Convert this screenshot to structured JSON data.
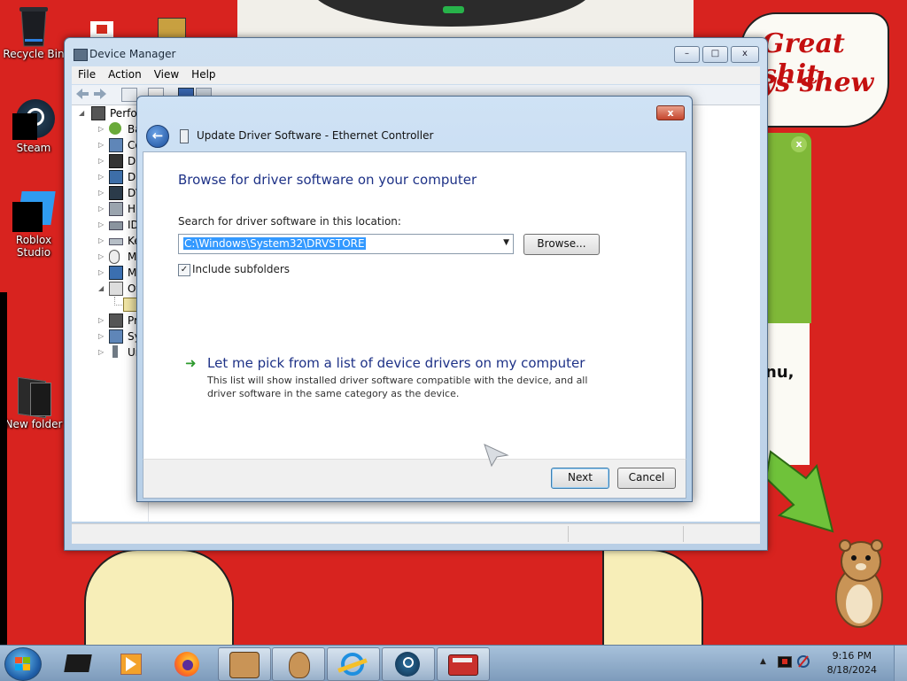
{
  "desktop": {
    "icons": [
      {
        "label": "Recycle Bin",
        "icon": "recycle-bin-icon"
      },
      {
        "label": "Steam",
        "icon": "steam-icon"
      },
      {
        "label": "Roblox Studio",
        "icon": "roblox-studio-icon"
      },
      {
        "label": "New folder",
        "icon": "folder-icon"
      }
    ],
    "wallpaper_text": {
      "bubble_line1": "Great shit",
      "bubble_line2": "ys shew",
      "side_text": "nu,"
    }
  },
  "device_manager": {
    "title": "Device Manager",
    "menu": [
      "File",
      "Action",
      "View",
      "Help"
    ],
    "tree": [
      {
        "label": "Perfor",
        "expanded": true
      },
      {
        "label": "Ba"
      },
      {
        "label": "Co"
      },
      {
        "label": "Di"
      },
      {
        "label": "Di"
      },
      {
        "label": "DV"
      },
      {
        "label": "Hu"
      },
      {
        "label": "ID"
      },
      {
        "label": "Ke"
      },
      {
        "label": "Mi"
      },
      {
        "label": "Mo"
      },
      {
        "label": "Ot",
        "expanded": true
      },
      {
        "label": ""
      },
      {
        "label": "Pr"
      },
      {
        "label": "Sy"
      },
      {
        "label": "Un"
      }
    ]
  },
  "dialog": {
    "title": "Update Driver Software - Ethernet Controller",
    "heading": "Browse for driver software on your computer",
    "search_label": "Search for driver software in this location:",
    "path_value": "C:\\Windows\\System32\\DRVSTORE",
    "browse_label": "Browse...",
    "include_subfolders_label": "Include subfolders",
    "include_subfolders_checked": true,
    "pick_title": "Let me pick from a list of device drivers on my computer",
    "pick_desc": "This list will show installed driver software compatible with the device, and all driver software in the same category as the device.",
    "next_label": "Next",
    "cancel_label": "Cancel",
    "close_glyph": "x"
  },
  "taskbar": {
    "pinned": [
      {
        "icon": "media-center-icon"
      },
      {
        "icon": "media-player-icon"
      },
      {
        "icon": "firefox-icon"
      },
      {
        "icon": "hamster-box-icon"
      },
      {
        "icon": "hamster-icon"
      },
      {
        "icon": "internet-explorer-icon"
      },
      {
        "icon": "steam-icon"
      },
      {
        "icon": "toolbox-icon"
      }
    ],
    "time": "9:16 PM",
    "date": "8/18/2024",
    "accent": "#1f5ea8"
  }
}
